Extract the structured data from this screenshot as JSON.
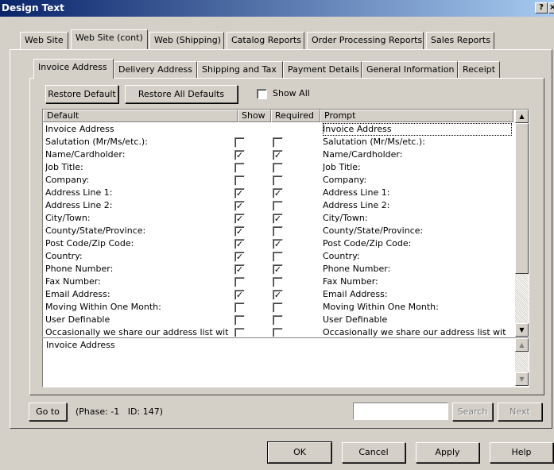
{
  "window": {
    "title": "Design Text",
    "help_btn": "?",
    "close_btn": "×"
  },
  "top_tabs": [
    "Web Site",
    "Web Site (cont)",
    "Web (Shipping)",
    "Catalog Reports",
    "Order Processing Reports",
    "Sales Reports"
  ],
  "top_tab_active": 1,
  "sub_tabs": [
    "Invoice Address",
    "Delivery Address",
    "Shipping and Tax",
    "Payment Details",
    "General Information",
    "Receipt"
  ],
  "sub_tab_active": 0,
  "toolbar": {
    "restore_default": "Restore Default",
    "restore_all": "Restore All Defaults",
    "show_all": "Show All",
    "show_all_checked": false
  },
  "grid": {
    "headers": {
      "default": "Default",
      "show": "Show",
      "required": "Required",
      "prompt": "Prompt"
    },
    "rows": [
      {
        "default": "Invoice Address",
        "show": null,
        "required": null,
        "prompt": "Invoice Address"
      },
      {
        "default": "Salutation (Mr/Ms/etc.):",
        "show": false,
        "required": false,
        "prompt": "Salutation (Mr/Ms/etc.):"
      },
      {
        "default": "Name/Cardholder:",
        "show": true,
        "required": true,
        "prompt": "Name/Cardholder:"
      },
      {
        "default": "Job Title:",
        "show": false,
        "required": false,
        "prompt": "Job Title:"
      },
      {
        "default": "Company:",
        "show": false,
        "required": false,
        "prompt": "Company:"
      },
      {
        "default": "Address Line 1:",
        "show": true,
        "required": true,
        "prompt": "Address Line 1:"
      },
      {
        "default": "Address Line 2:",
        "show": true,
        "required": false,
        "prompt": "Address Line 2:"
      },
      {
        "default": "City/Town:",
        "show": true,
        "required": true,
        "prompt": "City/Town:"
      },
      {
        "default": "County/State/Province:",
        "show": true,
        "required": false,
        "prompt": "County/State/Province:"
      },
      {
        "default": "Post Code/Zip Code:",
        "show": true,
        "required": true,
        "prompt": "Post Code/Zip Code:"
      },
      {
        "default": "Country:",
        "show": true,
        "required": false,
        "prompt": "Country:"
      },
      {
        "default": "Phone Number:",
        "show": true,
        "required": true,
        "prompt": "Phone Number:"
      },
      {
        "default": "Fax Number:",
        "show": false,
        "required": false,
        "prompt": "Fax Number:"
      },
      {
        "default": "Email Address:",
        "show": true,
        "required": true,
        "prompt": "Email Address:"
      },
      {
        "default": "Moving Within One Month:",
        "show": false,
        "required": false,
        "prompt": "Moving Within One Month:"
      },
      {
        "default": "User Definable",
        "show": false,
        "required": false,
        "prompt": "User Definable"
      },
      {
        "default": "Occasionally we share our address list wit",
        "show": false,
        "required": false,
        "prompt": "Occasionally we share our address list wit"
      }
    ]
  },
  "detail_text": "Invoice Address",
  "status": {
    "goto_label": "Go to",
    "phase_info": "(Phase: -1   ID: 147)",
    "search_value": "",
    "search_btn": "Search",
    "next_btn": "Next"
  },
  "footer": {
    "ok": "OK",
    "cancel": "Cancel",
    "apply": "Apply",
    "help": "Help"
  }
}
